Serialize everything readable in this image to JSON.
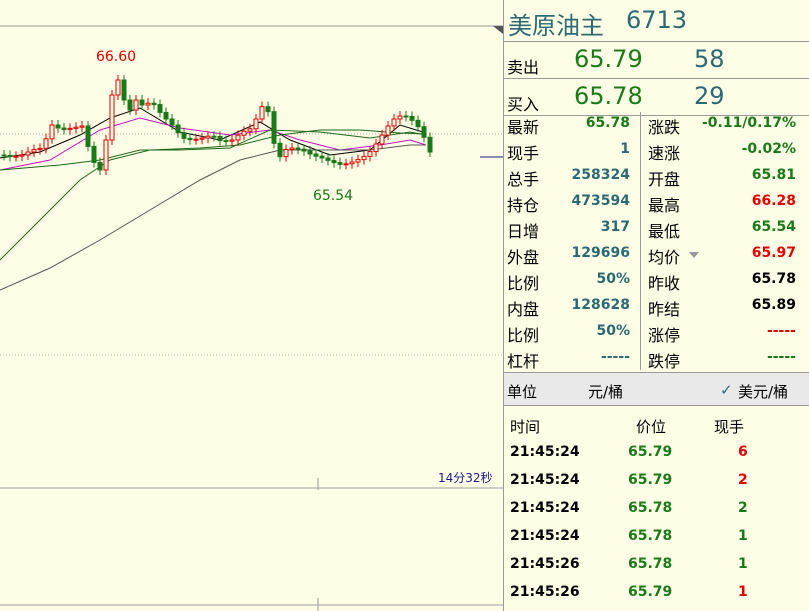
{
  "chart": {
    "high_label": "66.60",
    "low_label": "65.54",
    "countdown": "14分32秒"
  },
  "header": {
    "name": "美原油主",
    "code": "6713"
  },
  "quote": {
    "sell": {
      "label": "卖出",
      "price": "65.79",
      "volume": "58"
    },
    "buy": {
      "label": "买入",
      "price": "65.78",
      "volume": "29"
    }
  },
  "stats": [
    {
      "l1": "最新",
      "v1": "65.78",
      "c1": "g",
      "l2": "涨跌",
      "v2": "-0.11/0.17%",
      "c2": "g"
    },
    {
      "l1": "现手",
      "v1": "1",
      "c1": "t",
      "l2": "速涨",
      "v2": "-0.02%",
      "c2": "g"
    },
    {
      "l1": "总手",
      "v1": "258324",
      "c1": "t",
      "l2": "开盘",
      "v2": "65.81",
      "c2": "g"
    },
    {
      "l1": "持仓",
      "v1": "473594",
      "c1": "t",
      "l2": "最高",
      "v2": "66.28",
      "c2": "r"
    },
    {
      "l1": "日增",
      "v1": "317",
      "c1": "t",
      "l2": "最低",
      "v2": "65.54",
      "c2": "g"
    },
    {
      "l1": "外盘",
      "v1": "129696",
      "c1": "t",
      "l2": "均价",
      "v2": "65.97",
      "c2": "r"
    },
    {
      "l1": "比例",
      "v1": "50%",
      "c1": "t",
      "l2": "昨收",
      "v2": "65.78",
      "c2": "k"
    },
    {
      "l1": "内盘",
      "v1": "128628",
      "c1": "t",
      "l2": "昨结",
      "v2": "65.89",
      "c2": "k"
    },
    {
      "l1": "比例",
      "v1": "50%",
      "c1": "t",
      "l2": "涨停",
      "v2": "-----",
      "c2": "r"
    },
    {
      "l1": "杠杆",
      "v1": "-----",
      "c1": "t",
      "l2": "跌停",
      "v2": "-----",
      "c2": "g"
    }
  ],
  "unit": {
    "label": "单位",
    "value": "元/桶",
    "check": "✓",
    "alt": "美元/桶"
  },
  "ticks": {
    "headers": {
      "time": "时间",
      "price": "价位",
      "qty": "现手"
    },
    "rows": [
      {
        "time": "21:45:24",
        "price": "65.79",
        "qty": "6",
        "qc": "r"
      },
      {
        "time": "21:45:24",
        "price": "65.79",
        "qty": "2",
        "qc": "r"
      },
      {
        "time": "21:45:24",
        "price": "65.78",
        "qty": "2",
        "qc": "g"
      },
      {
        "time": "21:45:24",
        "price": "65.78",
        "qty": "1",
        "qc": "g"
      },
      {
        "time": "21:45:26",
        "price": "65.78",
        "qty": "1",
        "qc": "g"
      },
      {
        "time": "21:45:26",
        "price": "65.79",
        "qty": "1",
        "qc": "r"
      }
    ]
  },
  "colors": {
    "up": "#e00000",
    "down": "#1a7a1a",
    "teal": "#2b6a74",
    "bg": "#fefee6"
  }
}
